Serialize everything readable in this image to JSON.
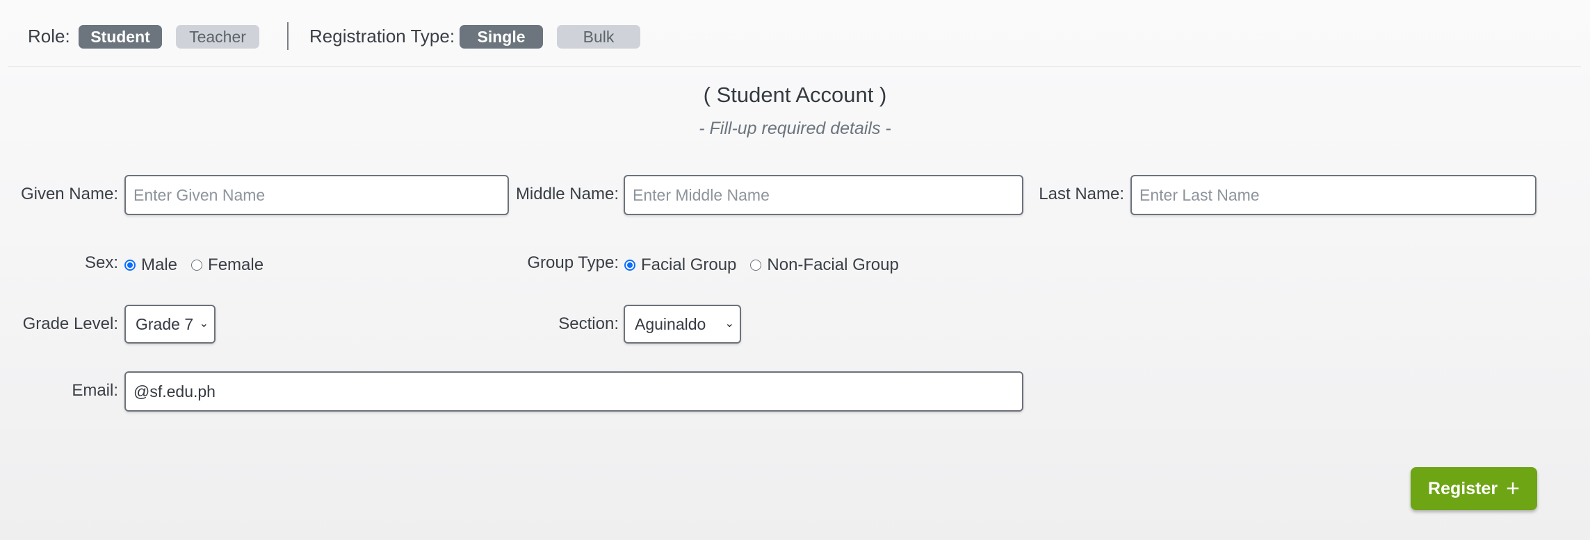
{
  "topbar": {
    "role_label": "Role:",
    "role_options": [
      "Student",
      "Teacher"
    ],
    "role_selected": "Student",
    "registration_label": "Registration Type:",
    "registration_options": [
      "Single",
      "Bulk"
    ],
    "registration_selected": "Single"
  },
  "form": {
    "title": "( Student Account )",
    "subtitle": "- Fill-up required details -",
    "given_name": {
      "label": "Given Name:",
      "placeholder": "Enter Given Name",
      "value": ""
    },
    "middle_name": {
      "label": "Middle Name:",
      "placeholder": "Enter Middle Name",
      "value": ""
    },
    "last_name": {
      "label": "Last Name:",
      "placeholder": "Enter Last Name",
      "value": ""
    },
    "sex": {
      "label": "Sex:",
      "options": [
        "Male",
        "Female"
      ],
      "selected": "Male"
    },
    "group_type": {
      "label": "Group Type:",
      "options": [
        "Facial Group",
        "Non-Facial Group"
      ],
      "selected": "Facial Group"
    },
    "grade_level": {
      "label": "Grade Level:",
      "value": "Grade 7"
    },
    "section": {
      "label": "Section:",
      "value": "Aguinaldo"
    },
    "email": {
      "label": "Email:",
      "value": "@sf.edu.ph"
    }
  },
  "actions": {
    "register_label": "Register",
    "register_icon": "plus-icon"
  },
  "colors": {
    "active_pill": "#6c757d",
    "inactive_pill": "#cfd3d9",
    "register": "#6ea515",
    "radio_checked": "#0d6efd"
  }
}
